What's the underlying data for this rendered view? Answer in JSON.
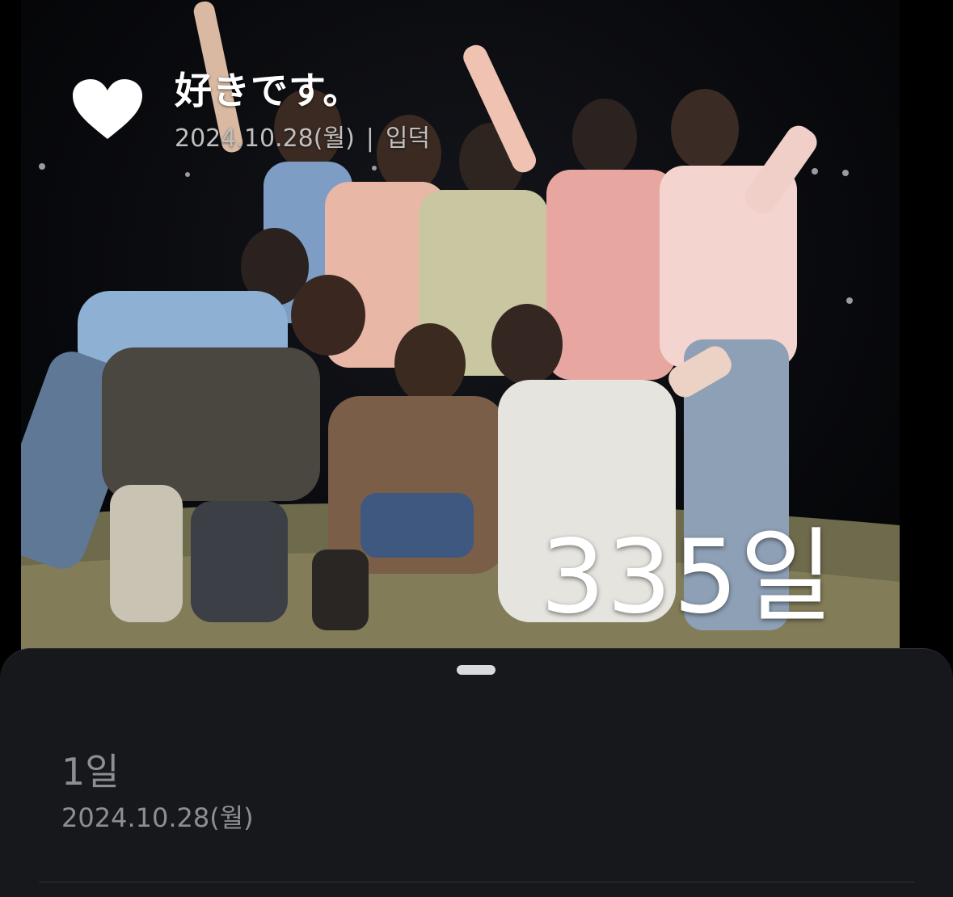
{
  "colors": {
    "sheet_background": "#17181c",
    "muted_text": "#8d8e94",
    "accent_white": "#ffffff"
  },
  "header": {
    "icon": "heart-icon",
    "title": "好きです。",
    "date": "2024.10.28(월)",
    "separator": "|",
    "category": "입덕"
  },
  "photo": {
    "description_icon": "group-photo",
    "dday": "335일"
  },
  "sheet": {
    "entries": [
      {
        "day_label": "1일",
        "date": "2024.10.28(월)"
      }
    ]
  }
}
